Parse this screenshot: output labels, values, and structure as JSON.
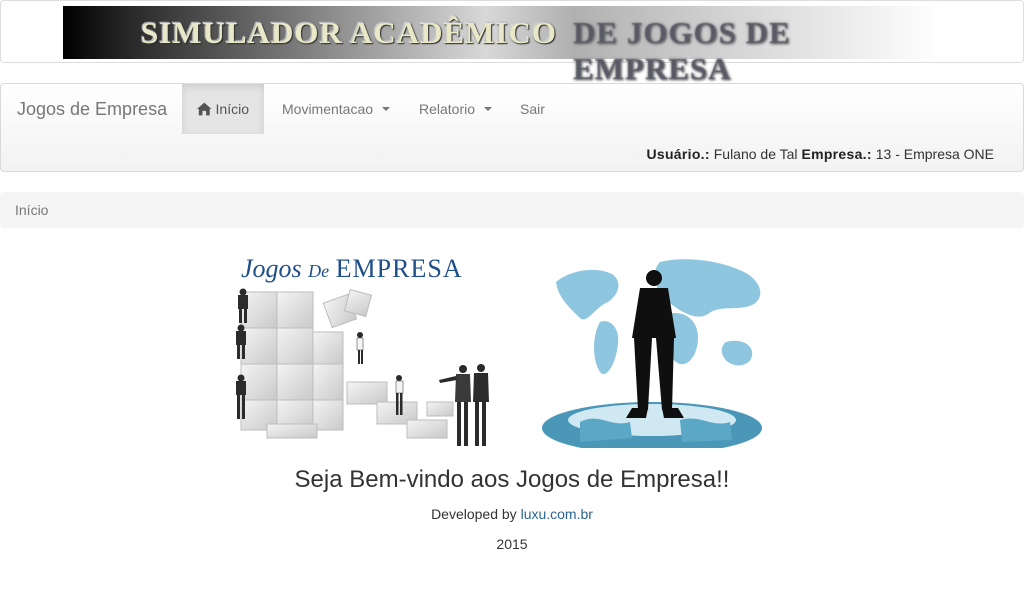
{
  "banner": {
    "part1": "SIMULADOR ACADÊMICO",
    "part2": "DE JOGOS DE EMPRESA"
  },
  "navbar": {
    "brand": "Jogos de Empresa",
    "items": [
      {
        "label": "Início",
        "icon": "home-icon",
        "active": true
      },
      {
        "label": "Movimentacao",
        "dropdown": true
      },
      {
        "label": "Relatorio",
        "dropdown": true
      },
      {
        "label": "Sair"
      }
    ],
    "user_label": "Usuário.:",
    "user_value": "Fulano de Tal",
    "company_label": "Empresa.:",
    "company_value": "13 - Empresa ONE"
  },
  "breadcrumb": {
    "current": "Início"
  },
  "hero": {
    "left_title_part1": "Jogos",
    "left_title_part2": "De",
    "left_title_part3": "EMPRESA"
  },
  "content": {
    "welcome": "Seja Bem-vindo aos Jogos de Empresa!!",
    "developed_prefix": "Developed by",
    "developer_link": "luxu.com.br",
    "year": "2015"
  },
  "colors": {
    "link": "#2a6496",
    "nav_active_bg": "#e5e5e5",
    "title_blue": "#1f4f8a",
    "map_blue": "#8ec6e0"
  }
}
